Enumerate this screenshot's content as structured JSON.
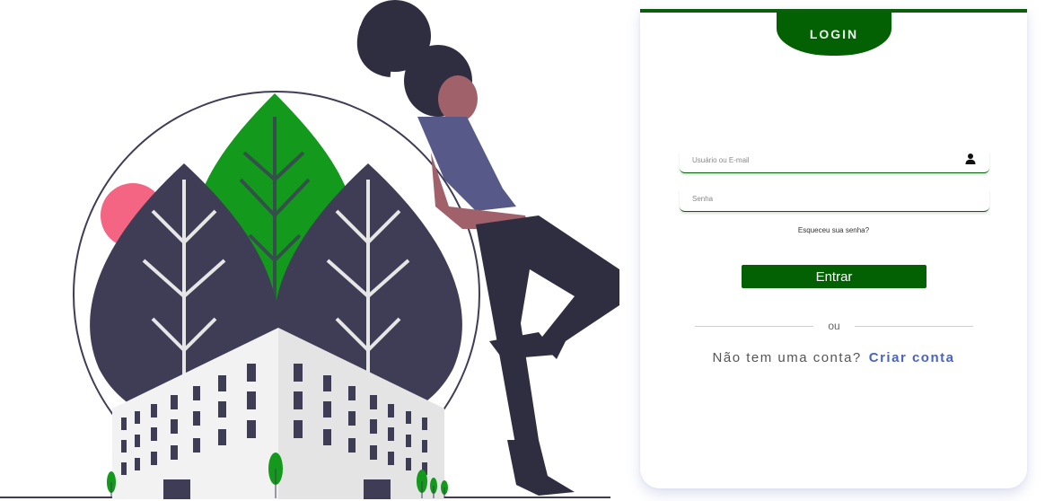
{
  "login_card": {
    "tab_label": "LOGIN",
    "username": {
      "placeholder": "Usuário ou E-mail",
      "value": ""
    },
    "password": {
      "placeholder": "Senha",
      "value": ""
    },
    "forgot_password": "Esqueceu sua senha?",
    "submit_label": "Entrar",
    "divider_text": "ou",
    "signup_prompt": "Não tem uma conta?",
    "signup_link": "Criar conta"
  },
  "colors": {
    "primary_green": "#036103",
    "link_blue": "#4a63c0",
    "leaf_green": "#139a1c",
    "dark_leaf": "#3f3d56",
    "pink_sun": "#f46584"
  },
  "icons": {
    "user": "user-icon"
  }
}
